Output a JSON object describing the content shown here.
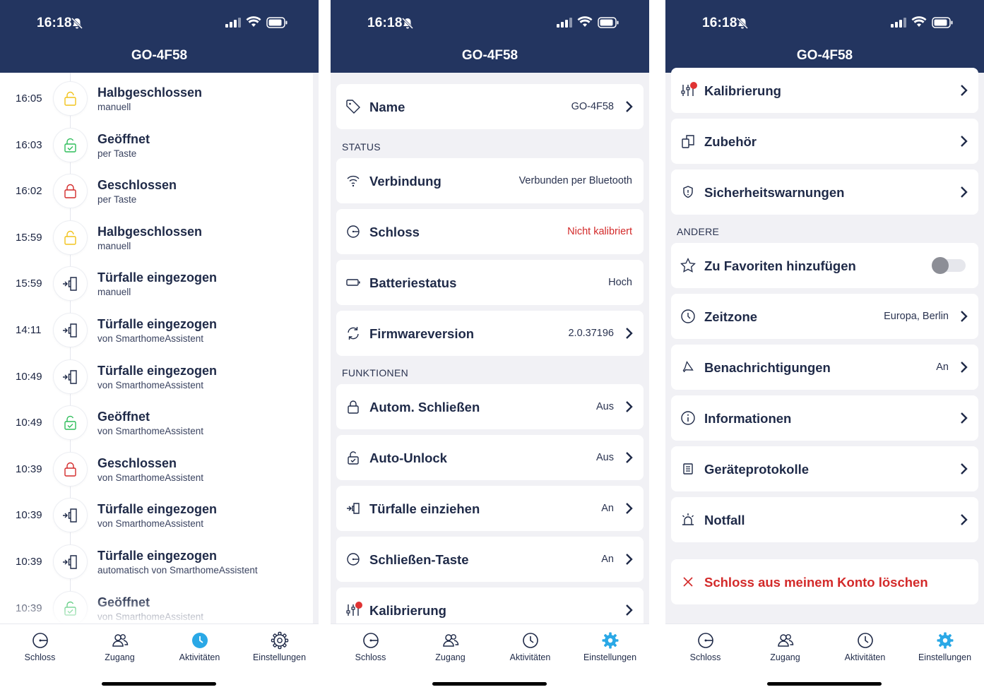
{
  "status_bar": {
    "time": "16:18"
  },
  "device_name": "GO-4F58",
  "colors": {
    "header": "#233560",
    "accent": "#2aa8e6",
    "red": "#d32a2a",
    "yellow": "#f2c31b",
    "green": "#2ebd5a"
  },
  "activities": [
    {
      "time": "16:05",
      "title": "Halbgeschlossen",
      "sub": "manuell",
      "icon": "lock-half-icon"
    },
    {
      "time": "16:03",
      "title": "Geöffnet",
      "sub": "per Taste",
      "icon": "lock-open-icon"
    },
    {
      "time": "16:02",
      "title": "Geschlossen",
      "sub": "per Taste",
      "icon": "lock-closed-icon"
    },
    {
      "time": "15:59",
      "title": "Halbgeschlossen",
      "sub": "manuell",
      "icon": "lock-half-icon"
    },
    {
      "time": "15:59",
      "title": "Türfalle eingezogen",
      "sub": "manuell",
      "icon": "latch-icon"
    },
    {
      "time": "14:11",
      "title": "Türfalle eingezogen",
      "sub": "von SmarthomeAssistent",
      "icon": "latch-icon"
    },
    {
      "time": "10:49",
      "title": "Türfalle eingezogen",
      "sub": "von SmarthomeAssistent",
      "icon": "latch-icon"
    },
    {
      "time": "10:49",
      "title": "Geöffnet",
      "sub": "von SmarthomeAssistent",
      "icon": "lock-open-icon"
    },
    {
      "time": "10:39",
      "title": "Geschlossen",
      "sub": "von SmarthomeAssistent",
      "icon": "lock-closed-icon"
    },
    {
      "time": "10:39",
      "title": "Türfalle eingezogen",
      "sub": "von SmarthomeAssistent",
      "icon": "latch-icon"
    },
    {
      "time": "10:39",
      "title": "Türfalle eingezogen",
      "sub": "automatisch von SmarthomeAssistent",
      "icon": "latch-icon"
    },
    {
      "time": "10:39",
      "title": "Geöffnet",
      "sub": "von SmarthomeAssistent",
      "icon": "lock-open-icon"
    }
  ],
  "settings_mid": {
    "name": {
      "label": "Name",
      "value": "GO-4F58"
    },
    "section_status": "STATUS",
    "verbindung": {
      "label": "Verbindung",
      "value": "Verbunden per Bluetooth"
    },
    "schloss": {
      "label": "Schloss",
      "value": "Nicht kalibriert"
    },
    "batterie": {
      "label": "Batteriestatus",
      "value": "Hoch"
    },
    "firmware": {
      "label": "Firmwareversion",
      "value": "2.0.37196"
    },
    "section_funktionen": "FUNKTIONEN",
    "autom_schliessen": {
      "label": "Autom. Schließen",
      "value": "Aus"
    },
    "auto_unlock": {
      "label": "Auto-Unlock",
      "value": "Aus"
    },
    "tuerfalle": {
      "label": "Türfalle einziehen",
      "value": "An"
    },
    "schliessen_taste": {
      "label": "Schließen-Taste",
      "value": "An"
    },
    "kalibrierung": {
      "label": "Kalibrierung"
    }
  },
  "settings_right": {
    "kalibrierung": {
      "label": "Kalibrierung"
    },
    "zubehoer": {
      "label": "Zubehör"
    },
    "sicherheit": {
      "label": "Sicherheitswarnungen"
    },
    "section_andere": "ANDERE",
    "favoriten": {
      "label": "Zu Favoriten hinzufügen",
      "enabled": false
    },
    "zeitzone": {
      "label": "Zeitzone",
      "value": "Europa, Berlin"
    },
    "benachrichtigungen": {
      "label": "Benachrichtigungen",
      "value": "An"
    },
    "informationen": {
      "label": "Informationen"
    },
    "geraeteprotokolle": {
      "label": "Geräteprotokolle"
    },
    "notfall": {
      "label": "Notfall"
    },
    "loeschen": {
      "label": "Schloss aus meinem Konto löschen"
    }
  },
  "nav": {
    "items": [
      {
        "label": "Schloss",
        "icon": "lock-dial-icon"
      },
      {
        "label": "Zugang",
        "icon": "users-icon"
      },
      {
        "label": "Aktivitäten",
        "icon": "clock-icon"
      },
      {
        "label": "Einstellungen",
        "icon": "gear-icon"
      }
    ]
  }
}
